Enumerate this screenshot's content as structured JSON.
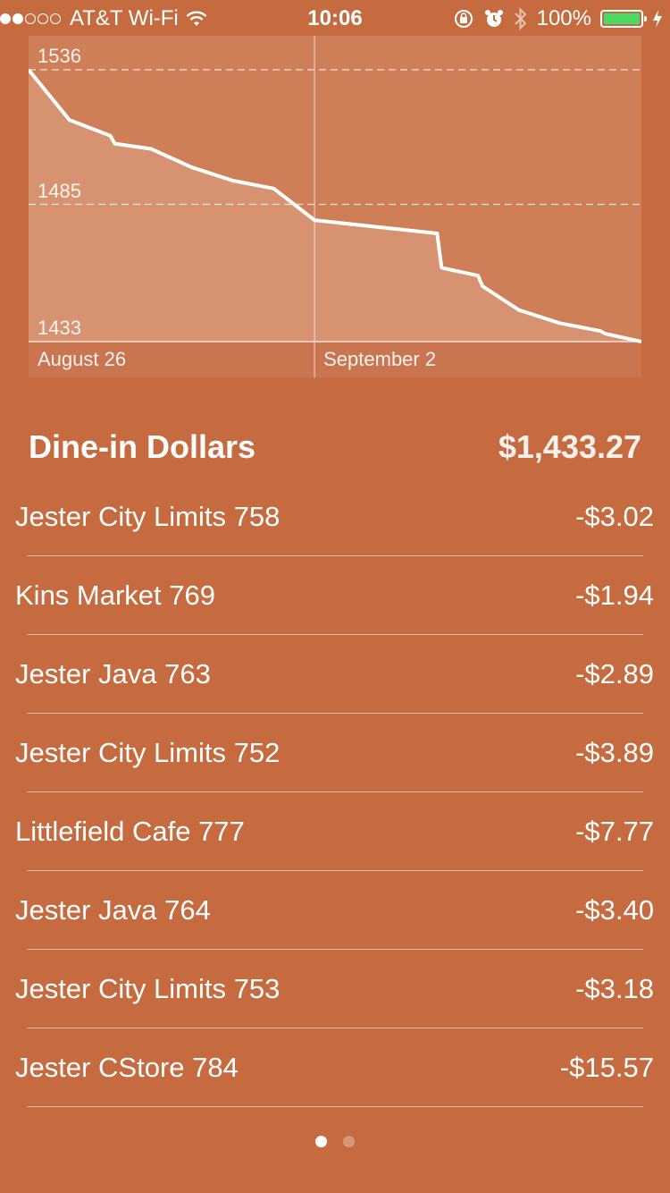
{
  "status_bar": {
    "signal_bars_filled": 2,
    "signal_bars_total": 5,
    "carrier": "AT&T Wi-Fi",
    "time": "10:06",
    "battery_percent": "100%",
    "battery_level": 1.0,
    "battery_color": "#4cd964",
    "icons": [
      "wifi-icon",
      "rotation-lock-icon",
      "alarm-icon",
      "bluetooth-icon",
      "battery-icon",
      "charging-bolt-icon"
    ]
  },
  "chart_data": {
    "type": "area",
    "title": "",
    "xlabel": "",
    "ylabel": "",
    "y_ticks": [
      "1536",
      "1485",
      "1433"
    ],
    "x_ticks": [
      "August 26",
      "September 2"
    ],
    "ylim": [
      1433,
      1536
    ],
    "grid": true,
    "series": [
      {
        "x": [
          "Aug 26",
          "Aug 27",
          "Aug 28",
          "Aug 28",
          "Aug 29",
          "Aug 30",
          "Aug 31",
          "Sep 1",
          "Sep 2",
          "Sep 5",
          "Sep 5",
          "Sep 6",
          "Sep 6",
          "Sep 7",
          "Sep 8",
          "Sep 9",
          "Sep 9",
          "Sep 10"
        ],
        "values": [
          1536,
          1517,
          1511,
          1508,
          1506,
          1499,
          1494,
          1491,
          1479,
          1474,
          1461,
          1458,
          1454,
          1445,
          1440,
          1437,
          1436,
          1433
        ]
      }
    ],
    "colors": {
      "line": "#ffffff",
      "fill": "#d9997a",
      "background": "#cf7f57"
    }
  },
  "balance": {
    "title": "Dine-in Dollars",
    "amount": "$1,433.27"
  },
  "transactions": [
    {
      "name": "Jester City Limits 758",
      "amount": "-$3.02"
    },
    {
      "name": "Kins Market 769",
      "amount": "-$1.94"
    },
    {
      "name": "Jester Java 763",
      "amount": "-$2.89"
    },
    {
      "name": "Jester City Limits 752",
      "amount": "-$3.89"
    },
    {
      "name": "Littlefield Cafe 777",
      "amount": "-$7.77"
    },
    {
      "name": "Jester Java 764",
      "amount": "-$3.40"
    },
    {
      "name": "Jester City Limits 753",
      "amount": "-$3.18"
    },
    {
      "name": "Jester CStore 784",
      "amount": "-$15.57"
    }
  ],
  "pager": {
    "pages": 2,
    "current": 1
  }
}
